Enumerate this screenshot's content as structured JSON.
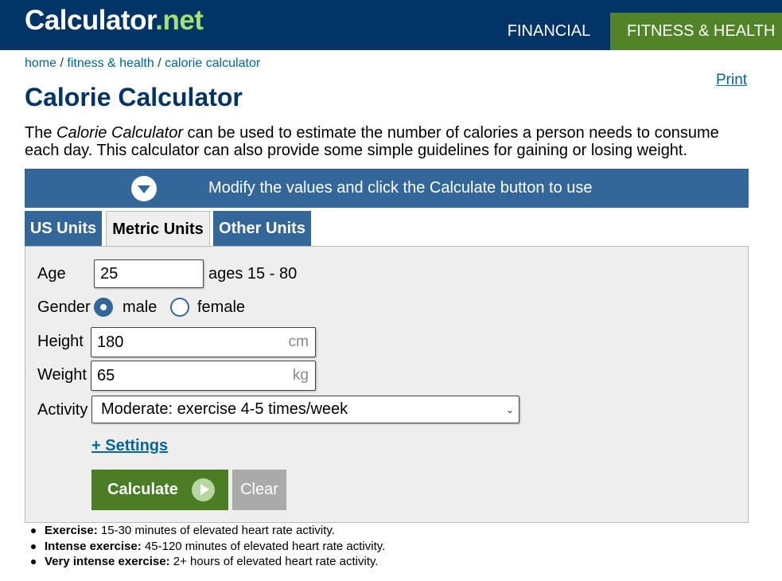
{
  "header": {
    "logo_main": "Calculator",
    "logo_ext": ".net",
    "nav": [
      {
        "label": "FINANCIAL"
      },
      {
        "label": "FITNESS & HEALTH"
      }
    ]
  },
  "breadcrumb": {
    "items": [
      "home",
      "fitness & health",
      "calorie calculator"
    ],
    "separator": " / "
  },
  "print_label": "Print",
  "page_title": "Calorie Calculator",
  "intro": {
    "pre": "The ",
    "emph": "Calorie Calculator",
    "post": " can be used to estimate the number of calories a person needs to consume each day. This calculator can also provide some simple guidelines for gaining or losing weight."
  },
  "modify_bar": {
    "text": "Modify the values and click the Calculate button to use",
    "icon": "chevron-down-circle-icon"
  },
  "tabs": [
    {
      "label": "US Units",
      "active": false
    },
    {
      "label": "Metric Units",
      "active": true
    },
    {
      "label": "Other Units",
      "active": false
    }
  ],
  "form": {
    "age": {
      "label": "Age",
      "value": "25",
      "hint": "ages 15 - 80"
    },
    "gender": {
      "label": "Gender",
      "options": [
        {
          "label": "male",
          "checked": true
        },
        {
          "label": "female",
          "checked": false
        }
      ]
    },
    "height": {
      "label": "Height",
      "value": "180",
      "unit": "cm"
    },
    "weight": {
      "label": "Weight",
      "value": "65",
      "unit": "kg"
    },
    "activity": {
      "label": "Activity",
      "selected": "Moderate: exercise 4-5 times/week"
    },
    "settings_label": "+ Settings",
    "calculate_label": "Calculate",
    "clear_label": "Clear"
  },
  "notes": [
    {
      "term": "Exercise:",
      "text": " 15-30 minutes of elevated heart rate activity."
    },
    {
      "term": "Intense exercise:",
      "text": " 45-120 minutes of elevated heart rate activity."
    },
    {
      "term": "Very intense exercise:",
      "text": " 2+ hours of elevated heart rate activity."
    }
  ],
  "colors": {
    "header_bg": "#003366",
    "accent_green": "#518428",
    "accent_blue": "#336699",
    "link": "#006699"
  }
}
